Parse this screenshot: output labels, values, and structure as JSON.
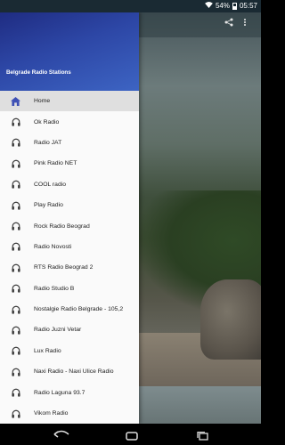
{
  "status_bar": {
    "battery": "54%",
    "time": "05:57"
  },
  "drawer": {
    "title": "Belgrade Radio Stations",
    "items": [
      {
        "label": "Home",
        "icon": "home-icon",
        "active": true
      },
      {
        "label": "Ok Radio",
        "icon": "headphones-icon"
      },
      {
        "label": "Radio JAT",
        "icon": "headphones-icon"
      },
      {
        "label": "Pink Radio NET",
        "icon": "headphones-icon"
      },
      {
        "label": "COOL radio",
        "icon": "headphones-icon"
      },
      {
        "label": "Play Radio",
        "icon": "headphones-icon"
      },
      {
        "label": "Rock Radio Beograd",
        "icon": "headphones-icon"
      },
      {
        "label": "Radio Novosti",
        "icon": "headphones-icon"
      },
      {
        "label": "RTS Radio Beograd 2",
        "icon": "headphones-icon"
      },
      {
        "label": "Radio Studio B",
        "icon": "headphones-icon"
      },
      {
        "label": "Nostalgie Radio Belgrade - 105,2",
        "icon": "headphones-icon"
      },
      {
        "label": "Radio Juzni Vetar",
        "icon": "headphones-icon"
      },
      {
        "label": "Lux Radio",
        "icon": "headphones-icon"
      },
      {
        "label": "Naxi Radio - Naxi Ulice Radio",
        "icon": "headphones-icon"
      },
      {
        "label": "Radio Laguna 93.7",
        "icon": "headphones-icon"
      },
      {
        "label": "Vikom Radio",
        "icon": "headphones-icon"
      }
    ]
  },
  "colors": {
    "header_start": "#1f2c82",
    "header_end": "#3d64c3",
    "active_icon": "#3f51b5",
    "icon": "#3a3a3a"
  }
}
